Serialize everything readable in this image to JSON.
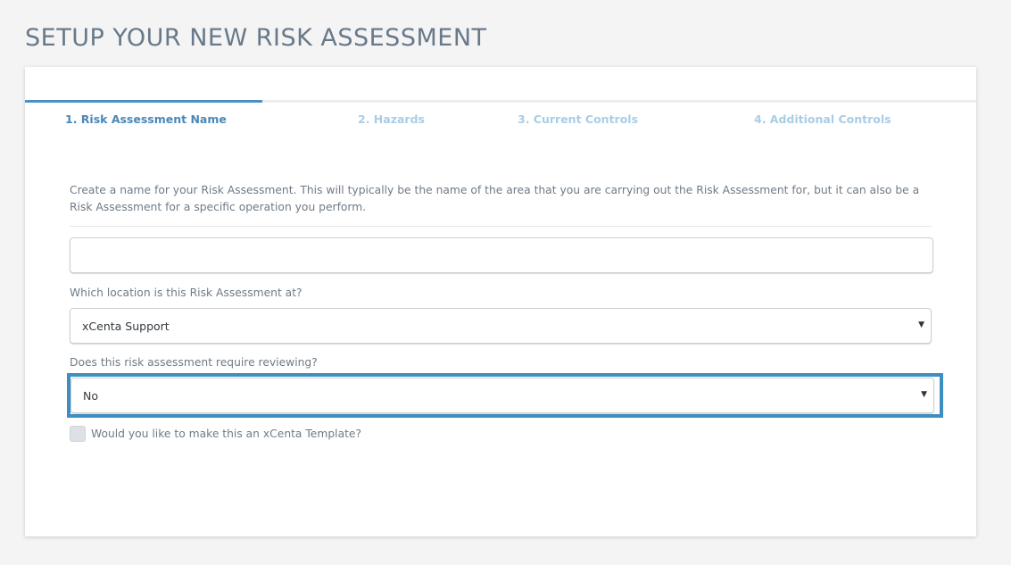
{
  "page": {
    "title": "SETUP YOUR NEW RISK ASSESSMENT"
  },
  "steps": [
    {
      "label": "1. Risk Assessment Name",
      "active": true
    },
    {
      "label": "2. Hazards",
      "active": false
    },
    {
      "label": "3. Current Controls",
      "active": false
    },
    {
      "label": "4. Additional Controls",
      "active": false
    }
  ],
  "form": {
    "intro_text": "Create a name for your Risk Assessment. This will typically be the name of the area that you are carrying out the Risk Assessment for, but it can also be a Risk Assessment for a specific operation you perform.",
    "name_field": {
      "value": "",
      "placeholder": ""
    },
    "location": {
      "label": "Which location is this Risk Assessment at?",
      "selected": "xCenta Support"
    },
    "review": {
      "label": "Does this risk assessment require reviewing?",
      "selected": "No"
    },
    "template": {
      "label": "Would you like to make this an xCenta Template?",
      "checked": false
    }
  },
  "icons": {
    "select_caret": "caret-down-icon"
  },
  "colors": {
    "accent": "#4a87b8",
    "step_inactive": "#a9cde6",
    "highlight_border": "#3d8ec2",
    "title": "#68798a"
  }
}
